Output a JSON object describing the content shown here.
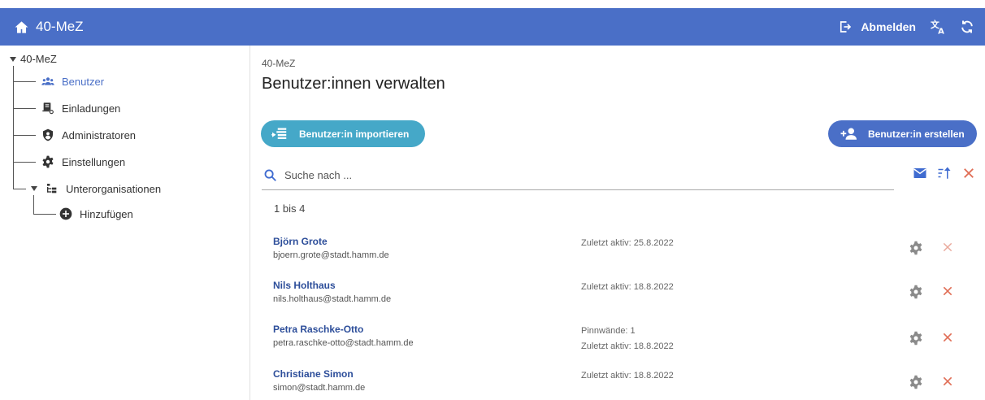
{
  "app": {
    "title": "40-MeZ",
    "home_icon": "home-icon"
  },
  "topbar": {
    "logout_label": "Abmelden",
    "logout_icon": "logout-icon",
    "translate_icon": "translate-icon",
    "refresh_icon": "refresh-icon"
  },
  "sidebar": {
    "root": "40-MeZ",
    "items": [
      {
        "label": "Benutzer",
        "icon": "users-icon",
        "active": true
      },
      {
        "label": "Einladungen",
        "icon": "invitation-icon"
      },
      {
        "label": "Administratoren",
        "icon": "admin-shield-icon"
      },
      {
        "label": "Einstellungen",
        "icon": "gear-icon"
      },
      {
        "label": "Unterorganisationen",
        "icon": "org-tree-icon"
      }
    ],
    "add_label": "Hinzufügen",
    "add_icon": "add-circle-icon"
  },
  "main": {
    "breadcrumb": "40-MeZ",
    "title": "Benutzer:innen verwalten",
    "import_button": "Benutzer:in importieren",
    "create_button": "Benutzer:in erstellen",
    "search_placeholder": "Suche nach ...",
    "count_text": "1 bis 4",
    "users": [
      {
        "name": "Björn Grote",
        "email": "bjoern.grote@stadt.hamm.de",
        "info_line1": "Zuletzt aktiv: 25.8.2022",
        "info_line2": ""
      },
      {
        "name": "Nils Holthaus",
        "email": "nils.holthaus@stadt.hamm.de",
        "info_line1": "Zuletzt aktiv: 18.8.2022",
        "info_line2": ""
      },
      {
        "name": "Petra Raschke-Otto",
        "email": "petra.raschke-otto@stadt.hamm.de",
        "info_line1": "Pinnwände: 1",
        "info_line2": "Zuletzt aktiv: 18.8.2022"
      },
      {
        "name": "Christiane Simon",
        "email": "simon@stadt.hamm.de",
        "info_line1": "Zuletzt aktiv: 18.8.2022",
        "info_line2": ""
      }
    ]
  },
  "colors": {
    "primary": "#4a6fc7",
    "import_button": "#45a8c8",
    "user_name": "#2d4e9a",
    "delete": "#e06d55",
    "gear": "#8a8a8a"
  }
}
